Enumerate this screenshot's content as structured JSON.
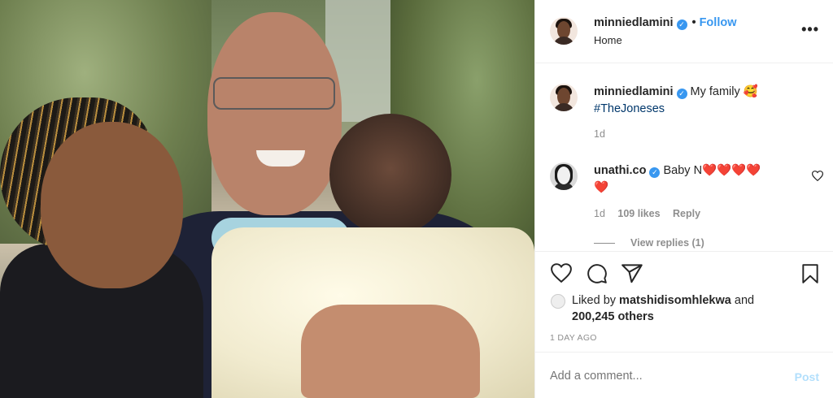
{
  "post": {
    "author": "minniedlamini",
    "follow_label": "Follow",
    "dot": "•",
    "location": "Home",
    "more_label": "•••"
  },
  "caption": {
    "username": "minniedlamini",
    "text": "My family",
    "emoji": "🥰",
    "hashtag": "#TheJoneses",
    "age": "1d"
  },
  "comment": {
    "username": "unathi.co",
    "text": "Baby N",
    "hearts": "❤️❤️❤️❤️",
    "hearts2": "❤️",
    "age": "1d",
    "likes": "109 likes",
    "reply_label": "Reply",
    "view_replies": "View replies (1)"
  },
  "likes": {
    "prefix": "Liked by",
    "user": "matshidisomhlekwa",
    "and": "and",
    "others": "200,245 others"
  },
  "timestamp": "1 DAY AGO",
  "composer": {
    "placeholder": "Add a comment...",
    "post_label": "Post"
  },
  "icons": {
    "like": "heart-icon",
    "comment": "comment-icon",
    "share": "share-icon",
    "save": "bookmark-icon",
    "verified": "verified-badge-icon"
  },
  "colors": {
    "accent": "#3897f0",
    "link": "#00376b",
    "muted": "#8e8e8e",
    "post_disabled": "#b2dffc"
  }
}
